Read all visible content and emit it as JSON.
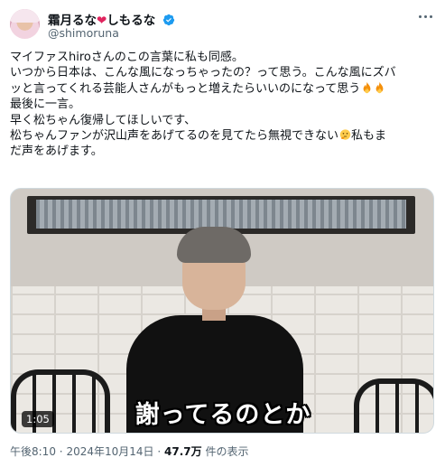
{
  "author": {
    "display_name": "霜月るな",
    "display_name_suffix": "しもるな",
    "handle": "@shimoruna",
    "verified": true
  },
  "tweet": {
    "lines": [
      "マイファスhiroさんのこの言葉に私も同感。",
      "いつから日本は、こんな風になっちゃったの？って思う。こんな風にズバ",
      "ッと言ってくれる芸能人さんがもっと増えたらいいのになって思う",
      "最後に一言。",
      "早く松ちゃん復帰してほしいです、",
      "松ちゃんファンが沢山声をあげてるのを見てたら無視できない",
      "私もま",
      "だ声をあげます。"
    ]
  },
  "media": {
    "caption": "謝ってるのとか",
    "duration": "1:05"
  },
  "meta": {
    "time": "午後8:10",
    "date": "2024年10月14日",
    "views": "47.7万",
    "views_label": "件の表示",
    "separator": "·"
  },
  "icons": [
    "heart-emoji-icon",
    "verified-badge-icon",
    "more-options-icon",
    "fire-emoji-icon",
    "thinking-face-emoji-icon"
  ],
  "colors": {
    "text": "#0f1419",
    "secondary": "#536471",
    "verified": "#1d9bf0",
    "heart": "#e0245e"
  }
}
